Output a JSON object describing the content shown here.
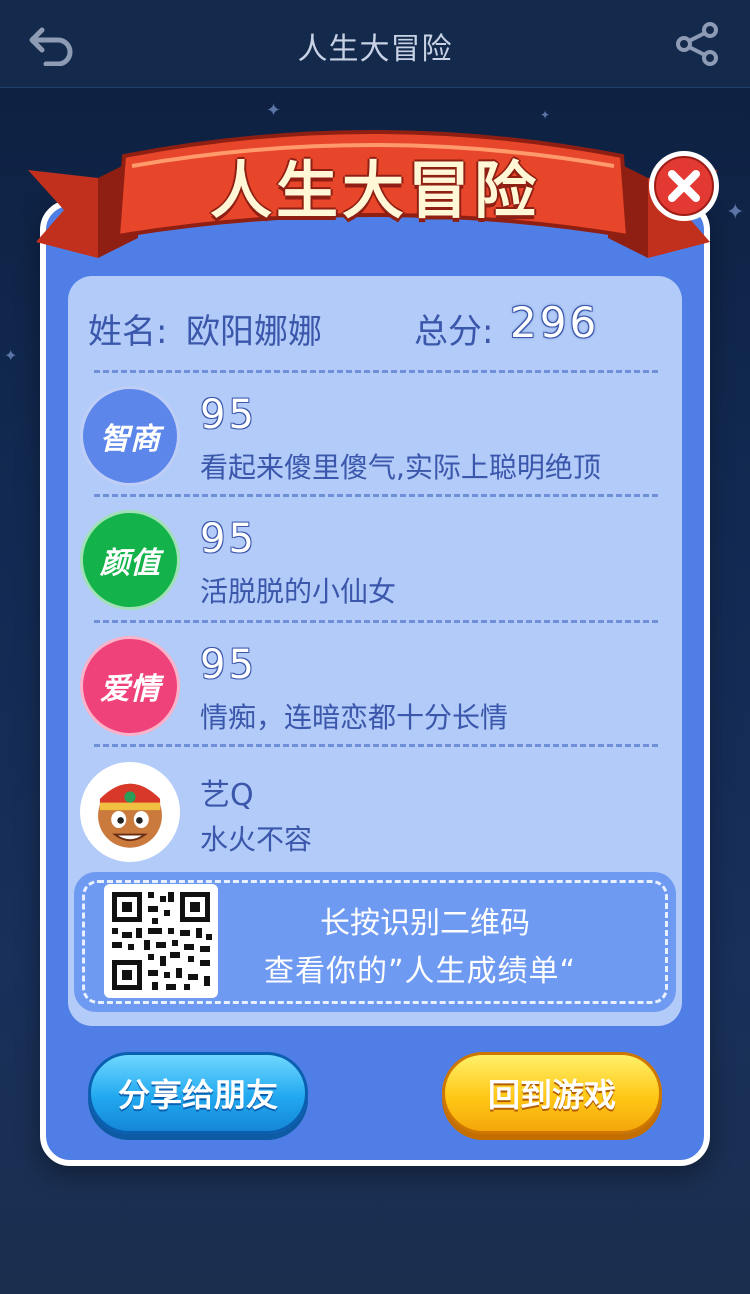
{
  "header": {
    "title": "人生大冒险",
    "back_icon": "back-arrow-icon",
    "share_icon": "share-icon"
  },
  "banner": {
    "title": "人生大冒险",
    "close_icon": "close-icon",
    "ribbon_color": "#e8462a"
  },
  "profile": {
    "name_label": "姓名:",
    "name_value": "欧阳娜娜",
    "score_label": "总分:",
    "score_value": "296"
  },
  "traits": [
    {
      "badge": "智商",
      "color": "#5d86ea",
      "score": "95",
      "desc": "看起来傻里傻气,实际上聪明绝顶"
    },
    {
      "badge": "颜值",
      "color": "#14b24a",
      "score": "95",
      "desc": "活脱脱的小仙女"
    },
    {
      "badge": "爱情",
      "color": "#f0427a",
      "score": "95",
      "desc": "情痴，连暗恋都十分长情"
    }
  ],
  "match": {
    "name": "艺Q",
    "desc": "水火不容"
  },
  "qr": {
    "line1": "长按识别二维码",
    "line2": "查看你的”人生成绩单“"
  },
  "buttons": {
    "share": "分享给朋友",
    "back_to_game": "回到游戏"
  }
}
